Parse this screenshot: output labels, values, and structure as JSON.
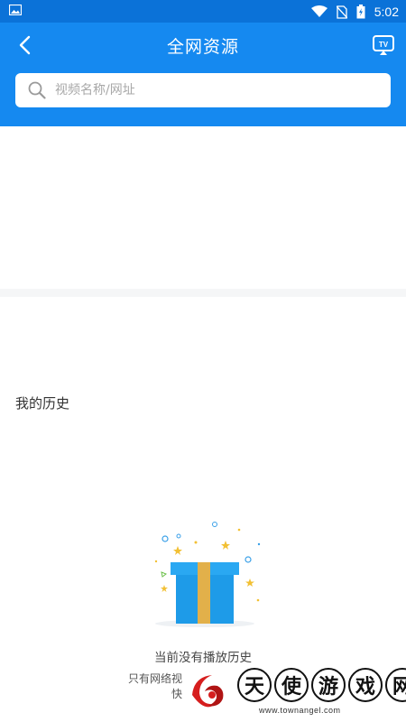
{
  "status_bar": {
    "time": "5:02",
    "icons": [
      "image-icon",
      "wifi-icon",
      "no-sim-icon",
      "battery-charging-icon"
    ]
  },
  "header": {
    "title": "全网资源",
    "back_icon": "back-arrow-icon",
    "tv_icon": "tv-cast-icon",
    "tv_label": "TV"
  },
  "search": {
    "placeholder": "视频名称/网址",
    "value": ""
  },
  "history": {
    "section_title": "我的历史",
    "empty_title": "当前没有播放历史",
    "empty_sub_line1": "只有网络视",
    "empty_sub_line2": "快"
  },
  "watermark": {
    "chars": [
      "天",
      "使",
      "游",
      "戏",
      "网"
    ],
    "url": "www.townangel.com"
  },
  "colors": {
    "statusbar": "#0b72d8",
    "appbar": "#1589f0",
    "gift_box": "#1e9be8",
    "gift_ribbon": "#e2b04a"
  }
}
